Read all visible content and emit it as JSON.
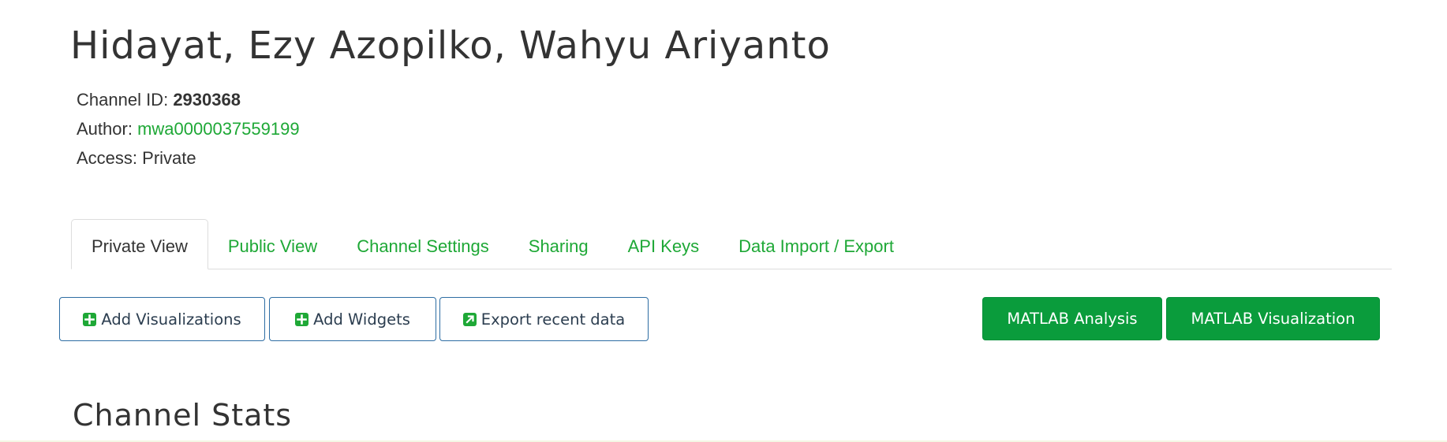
{
  "channel": {
    "title": "Hidayat, Ezy Azopilko, Wahyu Ariyanto",
    "id_label": "Channel ID:",
    "id_value": "2930368",
    "author_label": "Author:",
    "author_value": "mwa0000037559199",
    "access_label": "Access:",
    "access_value": "Private"
  },
  "tabs": [
    {
      "label": "Private View",
      "active": true
    },
    {
      "label": "Public View",
      "active": false
    },
    {
      "label": "Channel Settings",
      "active": false
    },
    {
      "label": "Sharing",
      "active": false
    },
    {
      "label": "API Keys",
      "active": false
    },
    {
      "label": "Data Import / Export",
      "active": false
    }
  ],
  "toolbar": {
    "add_visualizations": {
      "label": "Add Visualizations",
      "icon": "plus-square-icon"
    },
    "add_widgets": {
      "label": "Add Widgets",
      "icon": "plus-square-icon"
    },
    "export_recent": {
      "label": "Export recent data",
      "icon": "external-link-square-icon"
    },
    "matlab_analysis": "MATLAB Analysis",
    "matlab_visualization": "MATLAB Visualization"
  },
  "sections": {
    "channel_stats": "Channel Stats"
  },
  "colors": {
    "accent_green": "#1ea836",
    "button_green": "#0a9c3c",
    "outline_blue": "#2d6da3",
    "text": "#333333"
  }
}
